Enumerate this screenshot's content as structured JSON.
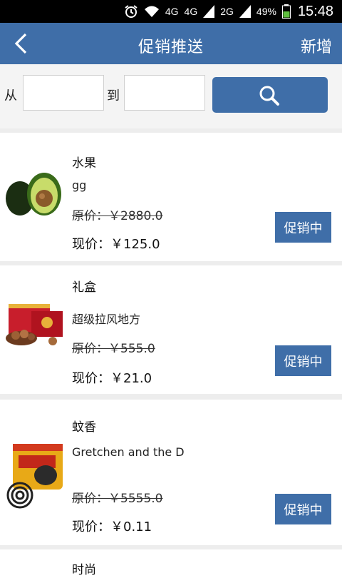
{
  "status_bar": {
    "network_1": "4G",
    "network_2": "4G",
    "network_3": "2G",
    "battery": "49%",
    "time": "15:48"
  },
  "header": {
    "back_icon": "chevron-left-icon",
    "title": "促销推送",
    "add_label": "新增"
  },
  "search": {
    "from_label": "从",
    "to_label": "到",
    "from_value": "",
    "to_value": "",
    "button_icon": "search-icon"
  },
  "colors": {
    "accent": "#3f6ea8",
    "background": "#ededed"
  },
  "products": [
    {
      "category": "水果",
      "name": "gg",
      "original_price": "原价：￥2880.0",
      "current_price": "现价：￥125.0",
      "status": "促销中",
      "image": "avocado"
    },
    {
      "category": "礼盒",
      "name": "超级拉风地方",
      "original_price": "原价：￥555.0",
      "current_price": "现价：￥21.0",
      "status": "促销中",
      "image": "gift-box"
    },
    {
      "category": "蚊香",
      "name": "Gretchen and the D",
      "original_price": "原价：￥5555.0",
      "current_price": "现价：￥0.11",
      "status": "促销中",
      "image": "mosquito-coil"
    },
    {
      "category": "时尚"
    }
  ]
}
